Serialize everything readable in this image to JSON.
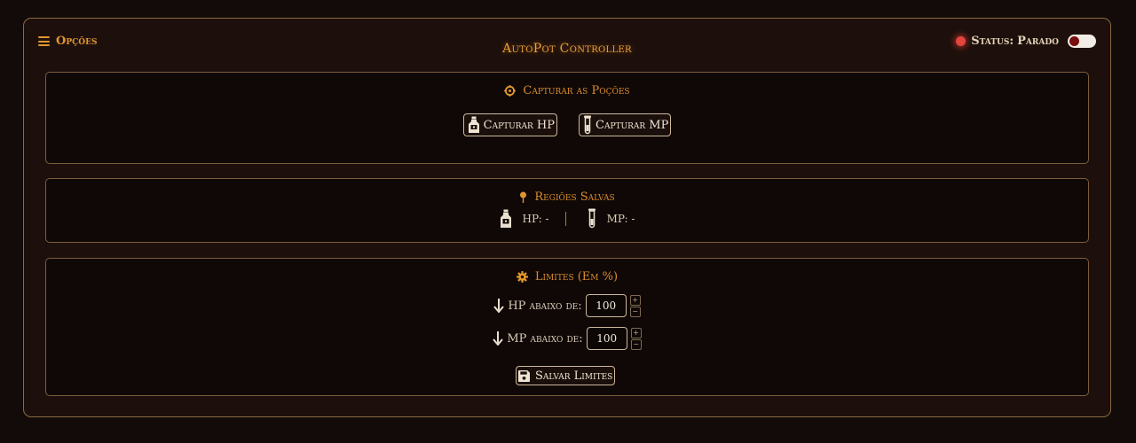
{
  "header": {
    "menu_label": "Opções",
    "title": "AutoPot Controller",
    "status_label": "Status:",
    "status_value": "Parado",
    "toggle_on": false
  },
  "capture": {
    "title": "Capturar as Poções",
    "hp_button": "Capturar HP",
    "mp_button": "Capturar MP"
  },
  "regions": {
    "title": "Regiões Salvas",
    "hp_text": "HP: -",
    "mp_text": "MP: -"
  },
  "limits": {
    "title": "Limites (Em %)",
    "hp_label": "HP abaixo de:",
    "hp_value": "100",
    "mp_label": "MP abaixo de:",
    "mp_value": "100",
    "save_button": "Salvar Limites"
  },
  "colors": {
    "accent": "#e0962e",
    "status_dot": "#e2453a",
    "border": "#8c6a42"
  },
  "icons": {
    "menu": "hamburger-icon",
    "capture": "crosshair-icon",
    "regions": "pin-icon",
    "limits": "gear-icon",
    "hp": "potion-bottle-icon",
    "mp": "test-tube-icon",
    "down": "arrow-down-icon",
    "save": "floppy-disk-icon"
  }
}
